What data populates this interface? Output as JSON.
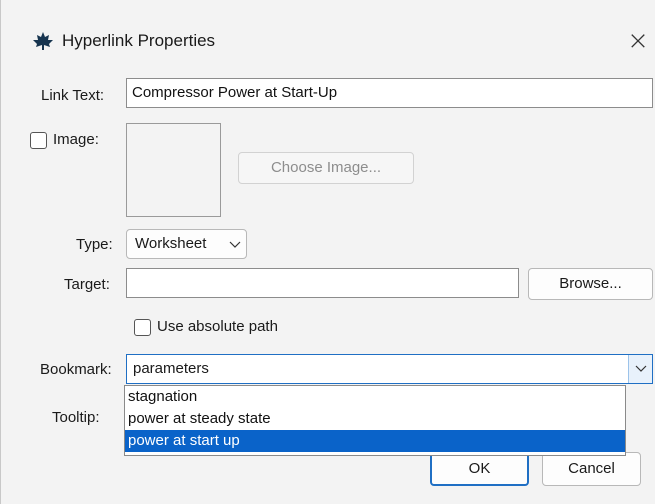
{
  "window": {
    "title": "Hyperlink Properties",
    "close_glyph": "×"
  },
  "icons": {
    "app": "maple-leaf-icon",
    "close": "close-icon",
    "chevron": "chevron-down-icon"
  },
  "form": {
    "link_text": {
      "label": "Link Text:",
      "value": "Compressor Power at Start-Up"
    },
    "image": {
      "label": "Image:",
      "checked": false,
      "choose_button": "Choose Image..."
    },
    "type": {
      "label": "Type:",
      "value": "Worksheet"
    },
    "target": {
      "label": "Target:",
      "value": "",
      "browse_button": "Browse..."
    },
    "absolute_path": {
      "label": "Use absolute path",
      "checked": false
    },
    "bookmark": {
      "label": "Bookmark:",
      "value": "parameters",
      "options": [
        "stagnation",
        "power at steady state",
        "power at start up"
      ],
      "highlighted": "power at start up"
    },
    "tooltip": {
      "label": "Tooltip:"
    }
  },
  "buttons": {
    "ok": "OK",
    "cancel": "Cancel"
  },
  "colors": {
    "accent": "#1f6fc4",
    "highlight": "#0a63c9",
    "dialog_bg": "#f3f3f3"
  }
}
